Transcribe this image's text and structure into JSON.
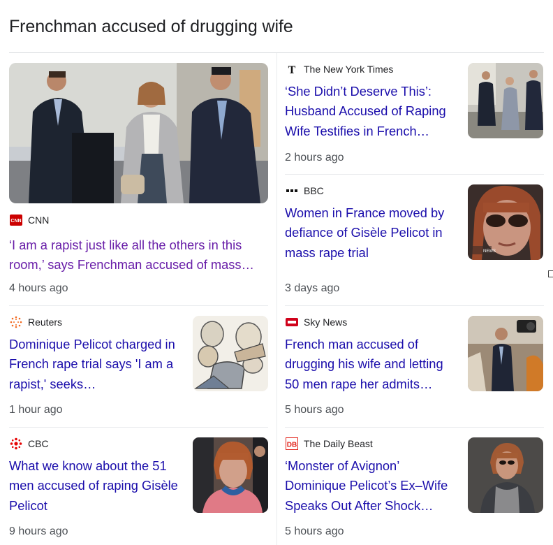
{
  "heading": "Frenchman accused of drugging wife",
  "articles": [
    {
      "source": "CNN",
      "headline": "‘I am a rapist just like all the others in this room,’ says Frenchman accused of mass…",
      "age": "4 hours ago",
      "logo": "cnn-logo",
      "visited": true
    },
    {
      "source": "The New York Times",
      "headline": "‘She Didn’t Deserve This’: Husband Accused of Raping Wife Testifies in French…",
      "age": "2 hours ago",
      "logo": "nyt-logo"
    },
    {
      "source": "BBC",
      "headline": "Women in France moved by defiance of Gisèle Pelicot in mass rape trial",
      "age": "3 days ago",
      "logo": "bbc-logo",
      "thumb_text": "NEWS"
    },
    {
      "source": "Reuters",
      "headline": "Dominique Pelicot charged in French rape trial says 'I am a rapist,' seeks…",
      "age": "1 hour ago",
      "logo": "reuters-logo"
    },
    {
      "source": "Sky News",
      "headline": "French man accused of drugging his wife and letting 50 men rape her admits…",
      "age": "5 hours ago",
      "logo": "sky-news-logo"
    },
    {
      "source": "CBC",
      "headline": "What we know about the 51 men accused of raping Gisèle Pelicot",
      "age": "9 hours ago",
      "logo": "cbc-logo"
    },
    {
      "source": "The Daily Beast",
      "headline": "‘Monster of Avignon’ Dominique Pelicot’s Ex–Wife Speaks Out After Shock…",
      "age": "5 hours ago",
      "logo": "daily-beast-logo"
    }
  ],
  "colors": {
    "link": "#1a0dab",
    "visited": "#681da8",
    "meta": "#4d5156",
    "divider": "#e8eaed"
  }
}
